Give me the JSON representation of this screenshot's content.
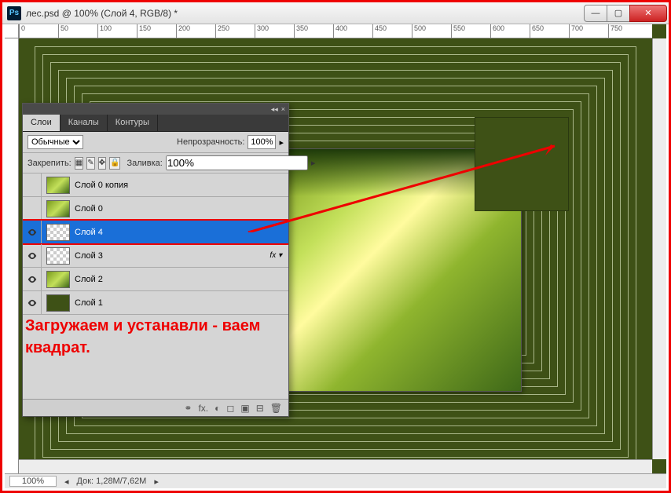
{
  "title": "лес.psd @ 100% (Слой 4, RGB/8) *",
  "ruler_marks": [
    "0",
    "50",
    "100",
    "150",
    "200",
    "250",
    "300",
    "350",
    "400",
    "450",
    "500",
    "550",
    "600",
    "650",
    "700",
    "750"
  ],
  "panel": {
    "tabs": [
      "Слои",
      "Каналы",
      "Контуры"
    ],
    "blend_mode": "Обычные",
    "opacity_label": "Непрозрачность:",
    "opacity_value": "100%",
    "lock_label": "Закрепить:",
    "fill_label": "Заливка:",
    "fill_value": "100%",
    "layers": [
      {
        "name": "Слой 0 копия",
        "visible": false,
        "thumb": "forest-t",
        "sel": false,
        "fx": ""
      },
      {
        "name": "Слой 0",
        "visible": false,
        "thumb": "forest-t",
        "sel": false,
        "fx": ""
      },
      {
        "name": "Слой 4",
        "visible": true,
        "thumb": "checker",
        "sel": true,
        "fx": "",
        "hilite": true
      },
      {
        "name": "Слой 3",
        "visible": true,
        "thumb": "checker",
        "sel": false,
        "fx": "fx ▾"
      },
      {
        "name": "Слой 2",
        "visible": true,
        "thumb": "forest-t",
        "sel": false,
        "fx": ""
      },
      {
        "name": "Слой 1",
        "visible": true,
        "thumb": "green-t",
        "sel": false,
        "fx": ""
      }
    ],
    "foot_icons": [
      "⚭",
      "fx.",
      "◐",
      "◻",
      "▣",
      "⊟",
      "🗑"
    ]
  },
  "annotation": "Загружаем и устанавли - ваем квадрат.",
  "status": {
    "zoom": "100%",
    "doc": "Док: 1,28M/7,62M"
  }
}
